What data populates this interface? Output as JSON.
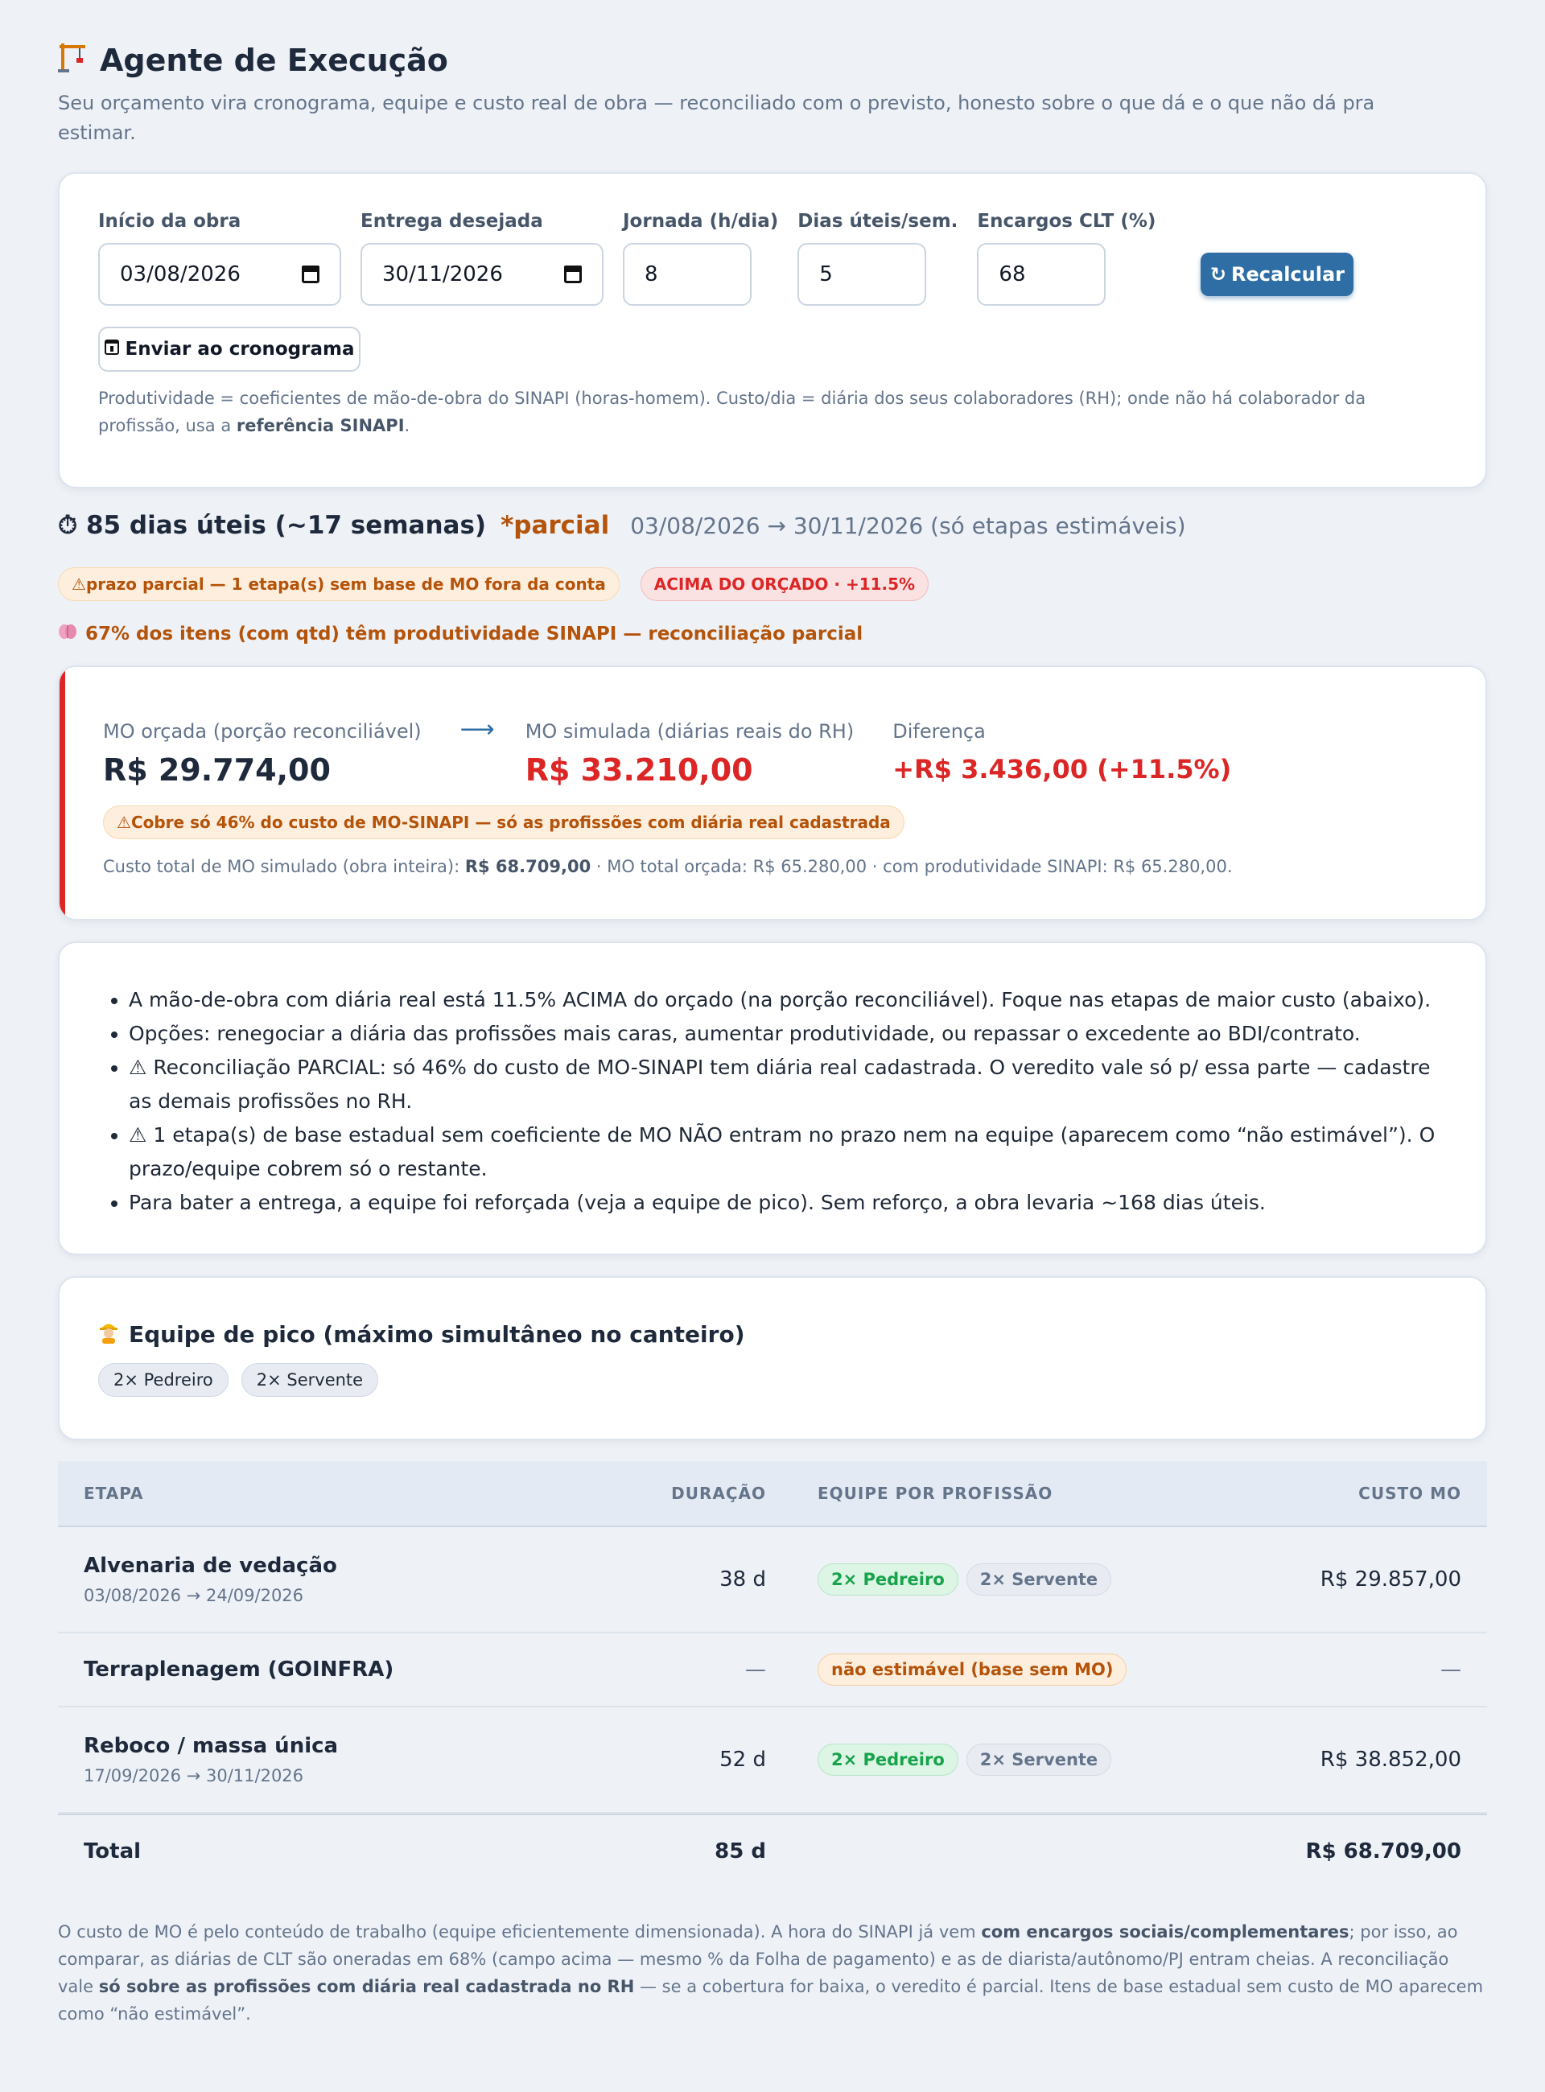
{
  "header": {
    "icon": "construction-crane-icon",
    "title": "Agente de Execução",
    "subtitle": "Seu orçamento vira cronograma, equipe e custo real de obra — reconciliado com o previsto, honesto sobre o que dá e o que não dá pra estimar."
  },
  "params": {
    "start_label": "Início da obra",
    "start_value": "03/08/2026",
    "end_label": "Entrega desejada",
    "end_value": "30/11/2026",
    "hours_label": "Jornada (h/dia)",
    "hours_value": "8",
    "days_label": "Dias úteis/sem.",
    "days_value": "5",
    "charges_label": "Encargos CLT (%)",
    "charges_value": "68",
    "recalc_label": "Recalcular",
    "send_label": "Enviar ao cronograma",
    "note_pre": "Produtividade = coeficientes de mão-de-obra do SINAPI (horas-homem). Custo/dia = diária dos seus colaboradores (RH); onde não há colaborador da profissão, usa a ",
    "note_bold": "referência SINAPI",
    "note_post": "."
  },
  "summary": {
    "duration": "85 dias úteis (~17 semanas)",
    "partial": "*parcial",
    "range": "03/08/2026 → 30/11/2026 (só etapas estimáveis)",
    "badge_warn": "prazo parcial — 1 etapa(s) sem base de MO fora da conta",
    "badge_danger": "ACIMA DO ORÇADO · +11.5%",
    "productivity": "67% dos itens (com qtd) têm produtividade SINAPI — reconciliação parcial"
  },
  "mo": {
    "budget_label": "MO orçada (porção reconciliável)",
    "budget_value": "R$ 29.774,00",
    "sim_label": "MO simulada (diárias reais do RH)",
    "sim_value": "R$ 33.210,00",
    "diff_label": "Diferença",
    "diff_value": "+R$ 3.436,00 (+11.5%)",
    "coverage_warn": "Cobre só 46% do custo de MO-SINAPI — só as profissões com diária real cadastrada",
    "foot_pre": "Custo total de MO simulado (obra inteira): ",
    "foot_bold": "R$ 68.709,00",
    "foot_post": " · MO total orçada: R$ 65.280,00 · com produtividade SINAPI: R$ 65.280,00."
  },
  "insights": [
    "A mão-de-obra com diária real está 11.5% ACIMA do orçado (na porção reconciliável). Foque nas etapas de maior custo (abaixo).",
    "Opções: renegociar a diária das profissões mais caras, aumentar produtividade, ou repassar o excedente ao BDI/contrato.",
    "⚠ Reconciliação PARCIAL: só 46% do custo de MO-SINAPI tem diária real cadastrada. O veredito vale só p/ essa parte — cadastre as demais profissões no RH.",
    "⚠ 1 etapa(s) de base estadual sem coeficiente de MO NÃO entram no prazo nem na equipe (aparecem como “não estimável”). O prazo/equipe cobrem só o restante.",
    "Para bater a entrega, a equipe foi reforçada (veja a equipe de pico). Sem reforço, a obra levaria ~168 dias úteis."
  ],
  "crew": {
    "title": "Equipe de pico (máximo simultâneo no canteiro)",
    "members": [
      "2× Pedreiro",
      "2× Servente"
    ]
  },
  "table": {
    "headers": [
      "ETAPA",
      "DURAÇÃO",
      "EQUIPE POR PROFISSÃO",
      "CUSTO MO"
    ],
    "rows": [
      {
        "name": "Alvenaria de vedação",
        "dates": "03/08/2026 → 24/09/2026",
        "duration": "38 d",
        "team": [
          "2× Pedreiro",
          "2× Servente"
        ],
        "cost": "R$ 29.857,00"
      },
      {
        "name": "Terraplenagem (GOINFRA)",
        "dates": "",
        "duration": "—",
        "team": [
          "não estimável (base sem MO)"
        ],
        "cost": "—"
      },
      {
        "name": "Reboco / massa única",
        "dates": "17/09/2026 → 30/11/2026",
        "duration": "52 d",
        "team": [
          "2× Pedreiro",
          "2× Servente"
        ],
        "cost": "R$ 38.852,00"
      }
    ],
    "total_label": "Total",
    "total_duration": "85 d",
    "total_cost": "R$ 68.709,00"
  },
  "footer": {
    "p1": "O custo de MO é pelo conteúdo de trabalho (equipe eficientemente dimensionada). A hora do SINAPI já vem ",
    "b1": "com encargos sociais/complementares",
    "p2": "; por isso, ao comparar, as diárias de CLT são oneradas em 68% (campo acima — mesmo % da Folha de pagamento) e as de diarista/autônomo/PJ entram cheias. A reconciliação vale ",
    "b2": "só sobre as profissões com diária real cadastrada no RH",
    "p3": " — se a cobertura for baixa, o veredito é parcial. Itens de base estadual sem custo de MO aparecem como “não estimável”."
  },
  "colors": {
    "accent": "#2e6ea5",
    "danger": "#dc2626",
    "warning": "#b45309",
    "success": "#16a34a"
  }
}
